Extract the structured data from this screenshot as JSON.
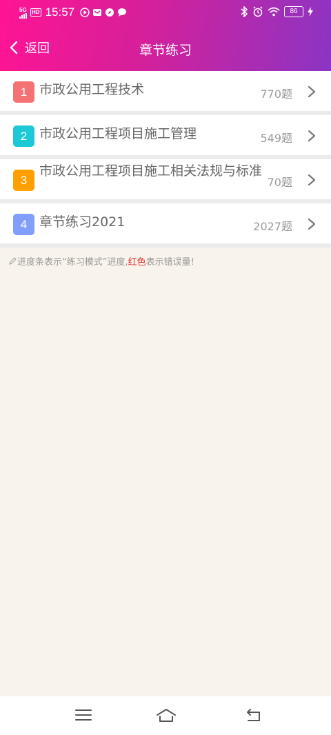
{
  "status_bar": {
    "network": "5G",
    "hd": "HD",
    "time": "15:57",
    "battery": "86"
  },
  "nav": {
    "back_label": "返回",
    "title": "章节练习"
  },
  "chapters": [
    {
      "index": "1",
      "name": "市政公用工程技术",
      "count": "770题",
      "color": "#f47174"
    },
    {
      "index": "2",
      "name": "市政公用工程项目施工管理",
      "count": "549题",
      "color": "#1dc8d7"
    },
    {
      "index": "3",
      "name": "市政公用工程项目施工相关法规与标准",
      "count": "70题",
      "color": "#ffa000"
    },
    {
      "index": "4",
      "name": "章节练习2021",
      "count": "2027题",
      "color": "#829efb"
    }
  ],
  "note": {
    "prefix": "进度条表示“练习模式”进度,",
    "red": "红色",
    "suffix": "表示错误量!"
  }
}
